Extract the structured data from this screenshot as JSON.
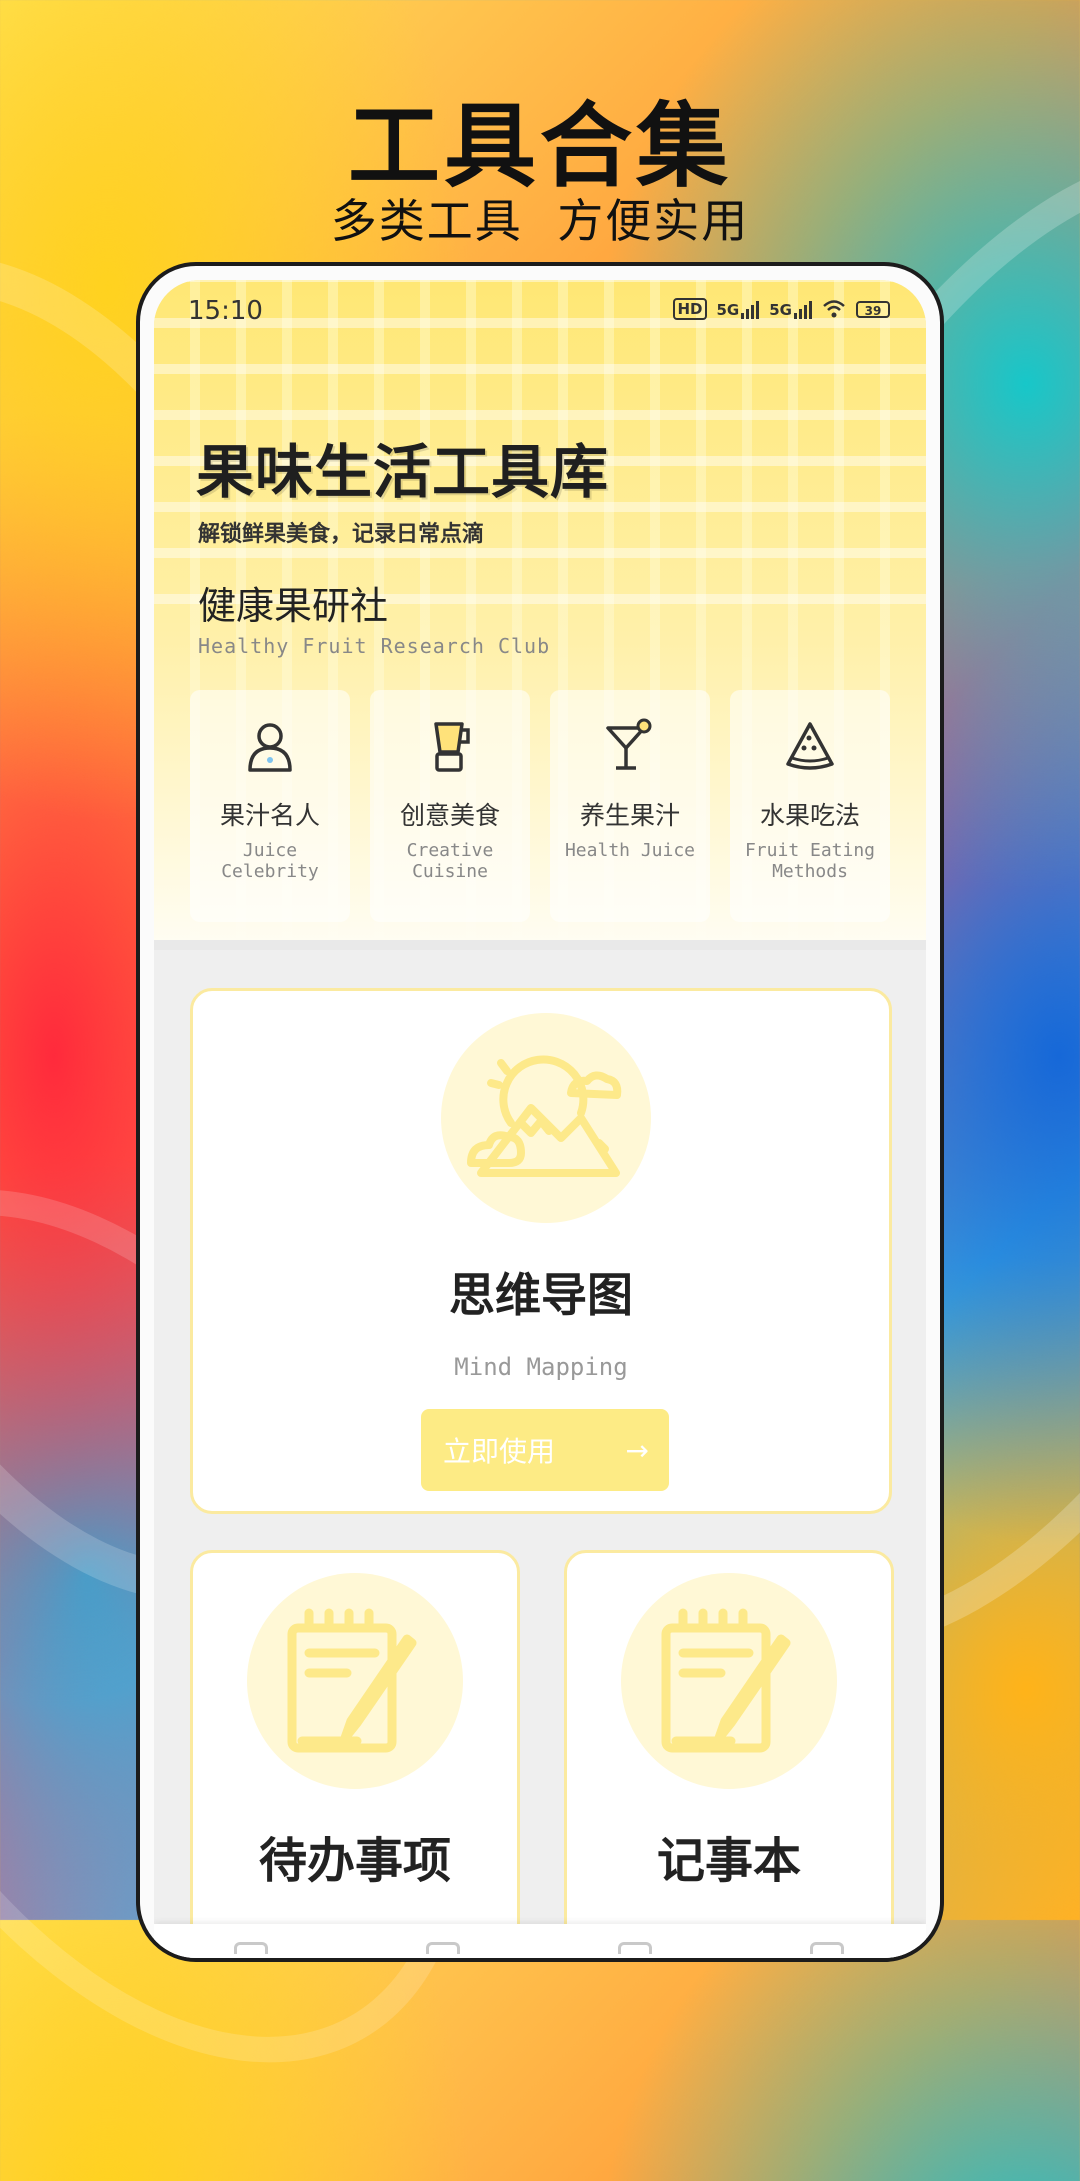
{
  "promo": {
    "title": "工具合集",
    "subtitle": "多类工具  方便实用"
  },
  "status_bar": {
    "time": "15:10",
    "hd_label": "HD",
    "net1": "5G",
    "net2": "5G",
    "battery": "39"
  },
  "header": {
    "app_title": "果味生活工具库",
    "app_subtitle": "解锁鲜果美食，记录日常点滴",
    "club_name": "健康果研社",
    "club_name_en": "Healthy Fruit Research Club"
  },
  "categories": [
    {
      "label": "果汁名人",
      "label_en": "Juice Celebrity",
      "icon": "person-icon"
    },
    {
      "label": "创意美食",
      "label_en": "Creative Cuisine",
      "icon": "blender-icon"
    },
    {
      "label": "养生果汁",
      "label_en": "Health Juice",
      "icon": "cocktail-icon"
    },
    {
      "label": "水果吃法",
      "label_en": "Fruit Eating Methods",
      "icon": "watermelon-slice-icon"
    }
  ],
  "featured_tool": {
    "title": "思维导图",
    "title_en": "Mind Mapping",
    "button_label": "立即使用",
    "button_arrow": "→",
    "icon": "mountain-sun-icon"
  },
  "tools": [
    {
      "title": "待办事项",
      "icon": "notepad-pen-icon"
    },
    {
      "title": "记事本",
      "icon": "notepad-pen-icon"
    }
  ],
  "colors": {
    "accent": "#fdeb85",
    "accent_light": "#fff8d6",
    "card_border": "#fbeaa0",
    "text_dark": "#222222"
  }
}
